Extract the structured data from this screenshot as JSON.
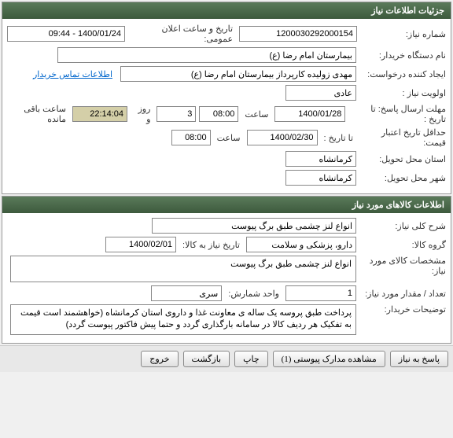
{
  "panel1": {
    "title": "جزئیات اطلاعات نیاز",
    "need_no_label": "شماره نیاز:",
    "need_no": "1200030292000154",
    "announce_label": "تاریخ و ساعت اعلان عمومی:",
    "announce_value": "1400/01/24 - 09:44",
    "device_label": "نام دستگاه خریدار:",
    "device_value": "بیمارستان امام رضا (ع)",
    "creator_label": "ایجاد کننده درخواست:",
    "creator_value": "مهدی زولیده کارپرداز بیمارستان امام رضا (ع)",
    "contact_link": "اطلاعات تماس خریدار",
    "priority_label": "اولویت نیاز :",
    "priority_value": "عادی",
    "deadline_label": "مهلت ارسال پاسخ:  تا تاریخ :",
    "deadline_date": "1400/01/28",
    "time_label": "ساعت",
    "deadline_time": "08:00",
    "days_value": "3",
    "days_label": "روز و",
    "remaining_time": "22:14:04",
    "remaining_label": "ساعت باقی مانده",
    "validity_label": "حداقل تاریخ اعتبار قیمت:",
    "validity_to": "تا تاریخ :",
    "validity_date": "1400/02/30",
    "validity_time": "08:00",
    "delivery_state_label": "استان محل تحویل:",
    "delivery_state": "کرمانشاه",
    "delivery_city_label": "شهر محل تحویل:",
    "delivery_city": "کرمانشاه"
  },
  "panel2": {
    "title": "اطلاعات کالاهای مورد نیاز",
    "general_desc_label": "شرح کلی نیاز:",
    "general_desc": "انواع لنز چشمی طبق برگ پیوست",
    "group_label": "گروه کالا:",
    "group_value": "دارو، پزشکی و سلامت",
    "group_date_label": "تاریخ نیاز به کالا:",
    "group_date": "1400/02/01",
    "spec_label": "مشخصات کالای مورد نیاز:",
    "spec_value": "انواع لنز چشمی طبق برگ پیوست",
    "qty_label": "تعداد / مقدار مورد نیاز:",
    "qty_value": "1",
    "unit_label": "واحد شمارش:",
    "unit_value": "سری",
    "notes_label": "توضیحات خریدار:",
    "notes_value": "پرداخت طبق پروسه یک ساله ی معاونت غذا و داروی استان کرمانشاه (خواهشمند است قیمت به تفکیک هر ردیف کالا در سامانه بارگذاری گردد و حتما پیش فاکتور پیوست گردد)"
  },
  "buttons": {
    "respond": "پاسخ به نیاز",
    "attachments": "مشاهده مدارک پیوستی (1)",
    "print": "چاپ",
    "back": "بازگشت",
    "exit": "خروج"
  }
}
